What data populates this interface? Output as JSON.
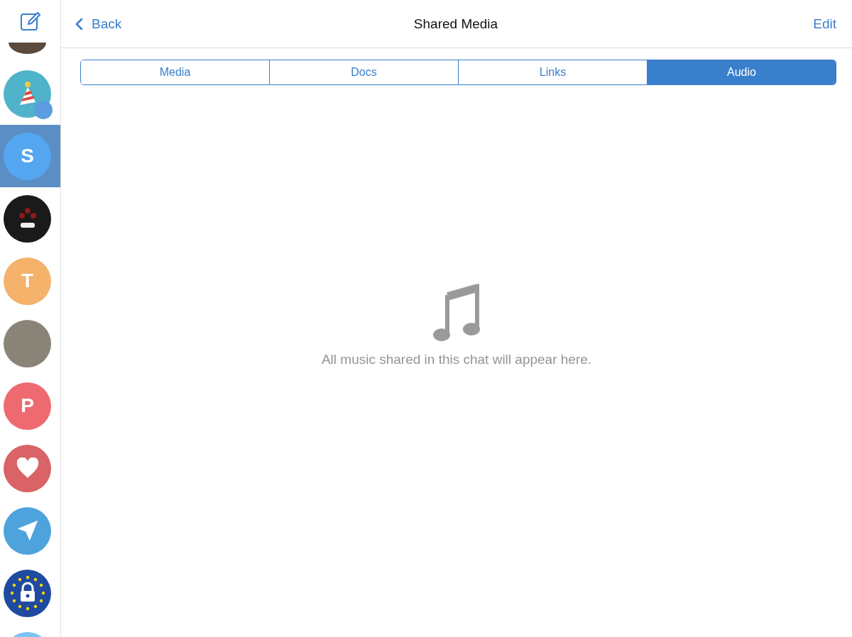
{
  "sidebar": {
    "chats": [
      {
        "kind": "photo",
        "selected": false
      },
      {
        "kind": "party",
        "selected": false
      },
      {
        "kind": "letter",
        "letter": "S",
        "color": "#55a6f0",
        "selected": true
      },
      {
        "kind": "monster",
        "selected": false
      },
      {
        "kind": "letter",
        "letter": "T",
        "color": "#f4b26a",
        "selected": false
      },
      {
        "kind": "photo",
        "selected": false
      },
      {
        "kind": "letter",
        "letter": "P",
        "color": "#ee6a70",
        "selected": false
      },
      {
        "kind": "heart",
        "selected": false
      },
      {
        "kind": "plane",
        "selected": false
      },
      {
        "kind": "lock",
        "selected": false
      },
      {
        "kind": "blank",
        "selected": false
      }
    ]
  },
  "header": {
    "back": "Back",
    "title": "Shared Media",
    "edit": "Edit"
  },
  "tabs": [
    {
      "label": "Media",
      "selected": false
    },
    {
      "label": "Docs",
      "selected": false
    },
    {
      "label": "Links",
      "selected": false
    },
    {
      "label": "Audio",
      "selected": true
    }
  ],
  "empty_state": {
    "message": "All music shared in this chat will appear here."
  }
}
